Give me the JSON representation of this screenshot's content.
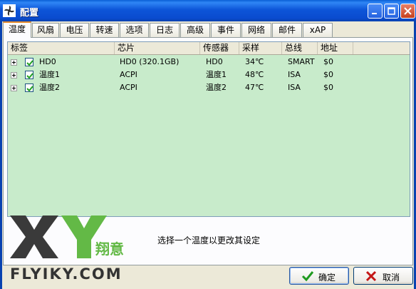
{
  "window": {
    "title": "配置"
  },
  "tabs": [
    {
      "label": "温度",
      "active": true
    },
    {
      "label": "风扇"
    },
    {
      "label": "电压"
    },
    {
      "label": "转速"
    },
    {
      "label": "选项"
    },
    {
      "label": "日志"
    },
    {
      "label": "高级"
    },
    {
      "label": "事件"
    },
    {
      "label": "网络"
    },
    {
      "label": "邮件"
    },
    {
      "label": "xAP"
    }
  ],
  "table": {
    "columns": [
      "标签",
      "芯片",
      "传感器",
      "采样",
      "总线",
      "地址"
    ],
    "rows": [
      {
        "label": "HD0",
        "chip": "HD0 (320.1GB)",
        "sensor": "HD0",
        "sample": "34℃",
        "bus": "SMART",
        "address": "$0",
        "checked": true
      },
      {
        "label": "温度1",
        "chip": "ACPI",
        "sensor": "温度1",
        "sample": "48℃",
        "bus": "ISA",
        "address": "$0",
        "checked": true
      },
      {
        "label": "温度2",
        "chip": "ACPI",
        "sensor": "温度2",
        "sample": "47℃",
        "bus": "ISA",
        "address": "$0",
        "checked": true
      }
    ]
  },
  "hint": "选择一个温度以更改其设定",
  "logo": {
    "letters": "XY",
    "tagline": "翔意",
    "site": "FLYIKY.COM"
  },
  "buttons": {
    "ok": "确定",
    "cancel": "取消"
  },
  "colors": {
    "list_bg": "#c8ebcb",
    "titlebar": "#0a4bcf",
    "logo_green": "#63b946",
    "logo_dark": "#3a3a3a"
  }
}
